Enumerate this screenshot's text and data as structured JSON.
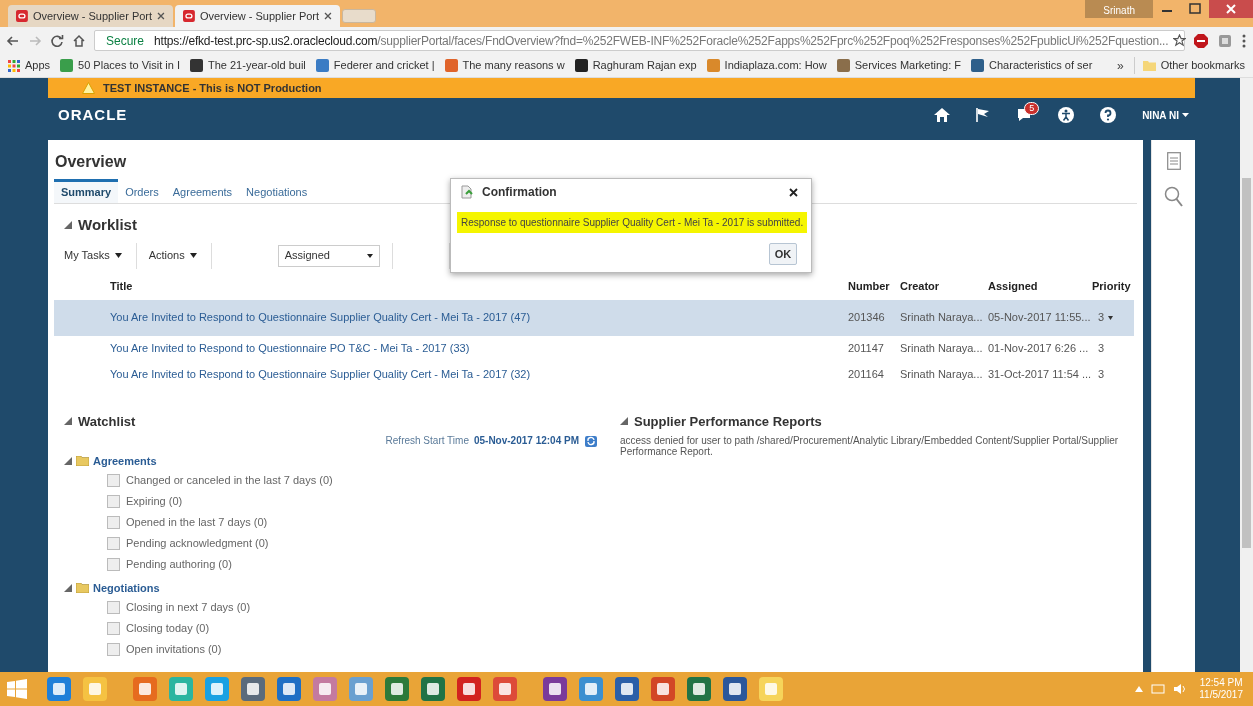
{
  "browser": {
    "tabs": [
      {
        "title": "Overview - Supplier Port",
        "selected": false
      },
      {
        "title": "Overview - Supplier Port",
        "selected": true
      }
    ],
    "profile": "Srinath",
    "address": {
      "secure_label": "Secure",
      "url_host": "https://efkd-test.prc-sp.us2.oraclecloud.com",
      "url_path": "/supplierPortal/faces/FndOverview?fnd=%252FWEB-INF%252Foracle%252Fapps%252Fprc%252Fpoq%252Fresponses%252FpublicUi%252Fquestion..."
    },
    "bookmarks": [
      "Apps",
      "50 Places to Visit in I",
      "The 21-year-old buil",
      "Federer and cricket |",
      "The many reasons w",
      "Raghuram Rajan exp",
      "Indiaplaza.com: How",
      "Services Marketing: F",
      "Characteristics of ser"
    ],
    "bookmarks_overflow": "»",
    "other_bookmarks": "Other bookmarks"
  },
  "banner": "TEST INSTANCE - This is NOT Production",
  "header": {
    "logo": "ORACLE",
    "notification_count": "5",
    "user": "NINA NI"
  },
  "page": {
    "title": "Overview",
    "tabs": [
      {
        "label": "Summary",
        "selected": true
      },
      {
        "label": "Orders",
        "selected": false
      },
      {
        "label": "Agreements",
        "selected": false
      },
      {
        "label": "Negotiations",
        "selected": false
      }
    ],
    "worklist": {
      "title": "Worklist",
      "expanded": true,
      "menus": [
        "My Tasks",
        "Actions"
      ],
      "filter": "Assigned",
      "columns": [
        "Title",
        "Number",
        "Creator",
        "Assigned",
        "Priority"
      ],
      "rows": [
        {
          "title": "You Are Invited to Respond to Questionnaire Supplier Quality Cert - Mei Ta - 2017 (47)",
          "number": "201346",
          "creator": "Srinath Naraya...",
          "assigned": "05-Nov-2017 11:55...",
          "priority": "3",
          "selected": true
        },
        {
          "title": "You Are Invited to Respond to Questionnaire PO T&C - Mei Ta - 2017 (33)",
          "number": "201147",
          "creator": "Srinath Naraya...",
          "assigned": "01-Nov-2017 6:26 ...",
          "priority": "3",
          "selected": false
        },
        {
          "title": "You Are Invited to Respond to Questionnaire Supplier Quality Cert - Mei Ta - 2017 (32)",
          "number": "201164",
          "creator": "Srinath Naraya...",
          "assigned": "31-Oct-2017 11:54 ...",
          "priority": "3",
          "selected": false
        }
      ]
    },
    "watchlist": {
      "title": "Watchlist",
      "expanded": true,
      "refresh_label": "Refresh Start Time",
      "refresh_time": "05-Nov-2017 12:04 PM",
      "groups": [
        {
          "label": "Agreements",
          "expanded": true,
          "children": [
            "Changed or canceled in the last 7 days (0)",
            "Expiring (0)",
            "Opened in the last 7 days (0)",
            "Pending acknowledgment (0)",
            "Pending authoring (0)"
          ]
        },
        {
          "label": "Negotiations",
          "expanded": true,
          "children": [
            "Closing in next 7 days (0)",
            "Closing today (0)",
            "Open invitations (0)"
          ]
        }
      ]
    },
    "reports": {
      "title": "Supplier Performance Reports",
      "expanded": true,
      "message": "access denied for user to path /shared/Procurement/Analytic Library/Embedded Content/Supplier Portal/Supplier Performance Report."
    }
  },
  "dialog": {
    "title": "Confirmation",
    "message": "Response to questionnaire Supplier Quality Cert - Mei Ta - 2017 is submitted.",
    "button": "OK"
  },
  "taskbar": {
    "time": "12:54 PM",
    "date": "11/5/2017"
  }
}
